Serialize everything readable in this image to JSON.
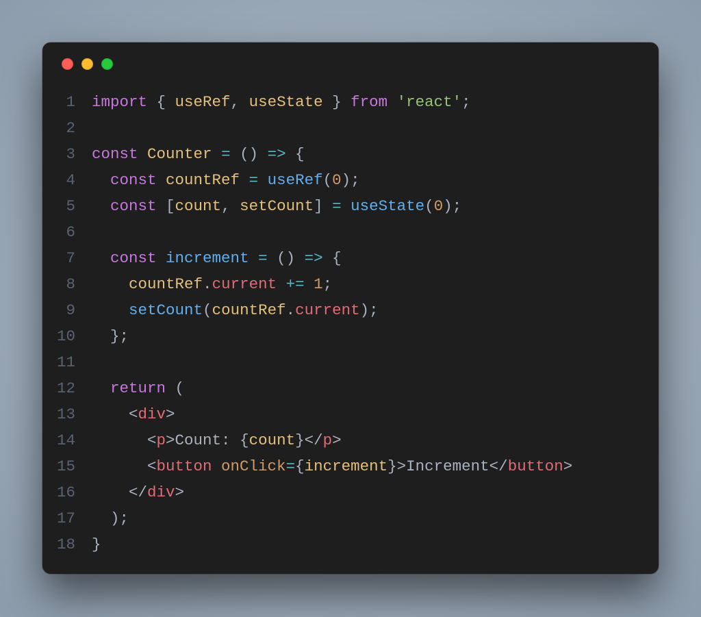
{
  "window": {
    "controls": [
      "close",
      "minimize",
      "zoom"
    ]
  },
  "editor": {
    "line_numbers": [
      "1",
      "2",
      "3",
      "4",
      "5",
      "6",
      "7",
      "8",
      "9",
      "10",
      "11",
      "12",
      "13",
      "14",
      "15",
      "16",
      "17",
      "18"
    ],
    "lines": [
      [
        {
          "t": "key",
          "s": "import"
        },
        {
          "t": "def",
          "s": " { "
        },
        {
          "t": "var",
          "s": "useRef"
        },
        {
          "t": "def",
          "s": ", "
        },
        {
          "t": "var",
          "s": "useState"
        },
        {
          "t": "def",
          "s": " } "
        },
        {
          "t": "key",
          "s": "from"
        },
        {
          "t": "def",
          "s": " "
        },
        {
          "t": "str",
          "s": "'react'"
        },
        {
          "t": "def",
          "s": ";"
        }
      ],
      [],
      [
        {
          "t": "key",
          "s": "const"
        },
        {
          "t": "def",
          "s": " "
        },
        {
          "t": "var",
          "s": "Counter"
        },
        {
          "t": "def",
          "s": " "
        },
        {
          "t": "op",
          "s": "="
        },
        {
          "t": "def",
          "s": " () "
        },
        {
          "t": "op",
          "s": "=>"
        },
        {
          "t": "def",
          "s": " {"
        }
      ],
      [
        {
          "t": "def",
          "s": "  "
        },
        {
          "t": "key",
          "s": "const"
        },
        {
          "t": "def",
          "s": " "
        },
        {
          "t": "var",
          "s": "countRef"
        },
        {
          "t": "def",
          "s": " "
        },
        {
          "t": "op",
          "s": "="
        },
        {
          "t": "def",
          "s": " "
        },
        {
          "t": "fn",
          "s": "useRef"
        },
        {
          "t": "def",
          "s": "("
        },
        {
          "t": "num",
          "s": "0"
        },
        {
          "t": "def",
          "s": ");"
        }
      ],
      [
        {
          "t": "def",
          "s": "  "
        },
        {
          "t": "key",
          "s": "const"
        },
        {
          "t": "def",
          "s": " ["
        },
        {
          "t": "var",
          "s": "count"
        },
        {
          "t": "def",
          "s": ", "
        },
        {
          "t": "var",
          "s": "setCount"
        },
        {
          "t": "def",
          "s": "] "
        },
        {
          "t": "op",
          "s": "="
        },
        {
          "t": "def",
          "s": " "
        },
        {
          "t": "fn",
          "s": "useState"
        },
        {
          "t": "def",
          "s": "("
        },
        {
          "t": "num",
          "s": "0"
        },
        {
          "t": "def",
          "s": ");"
        }
      ],
      [],
      [
        {
          "t": "def",
          "s": "  "
        },
        {
          "t": "key",
          "s": "const"
        },
        {
          "t": "def",
          "s": " "
        },
        {
          "t": "fn",
          "s": "increment"
        },
        {
          "t": "def",
          "s": " "
        },
        {
          "t": "op",
          "s": "="
        },
        {
          "t": "def",
          "s": " () "
        },
        {
          "t": "op",
          "s": "=>"
        },
        {
          "t": "def",
          "s": " {"
        }
      ],
      [
        {
          "t": "def",
          "s": "    "
        },
        {
          "t": "var",
          "s": "countRef"
        },
        {
          "t": "def",
          "s": "."
        },
        {
          "t": "prop",
          "s": "current"
        },
        {
          "t": "def",
          "s": " "
        },
        {
          "t": "op",
          "s": "+="
        },
        {
          "t": "def",
          "s": " "
        },
        {
          "t": "num",
          "s": "1"
        },
        {
          "t": "def",
          "s": ";"
        }
      ],
      [
        {
          "t": "def",
          "s": "    "
        },
        {
          "t": "fn",
          "s": "setCount"
        },
        {
          "t": "def",
          "s": "("
        },
        {
          "t": "var",
          "s": "countRef"
        },
        {
          "t": "def",
          "s": "."
        },
        {
          "t": "prop",
          "s": "current"
        },
        {
          "t": "def",
          "s": ");"
        }
      ],
      [
        {
          "t": "def",
          "s": "  };"
        }
      ],
      [],
      [
        {
          "t": "def",
          "s": "  "
        },
        {
          "t": "key",
          "s": "return"
        },
        {
          "t": "def",
          "s": " ("
        }
      ],
      [
        {
          "t": "def",
          "s": "    <"
        },
        {
          "t": "tag",
          "s": "div"
        },
        {
          "t": "def",
          "s": ">"
        }
      ],
      [
        {
          "t": "def",
          "s": "      <"
        },
        {
          "t": "tag",
          "s": "p"
        },
        {
          "t": "def",
          "s": ">"
        },
        {
          "t": "plain",
          "s": "Count: "
        },
        {
          "t": "def",
          "s": "{"
        },
        {
          "t": "var",
          "s": "count"
        },
        {
          "t": "def",
          "s": "}</"
        },
        {
          "t": "tag",
          "s": "p"
        },
        {
          "t": "def",
          "s": ">"
        }
      ],
      [
        {
          "t": "def",
          "s": "      <"
        },
        {
          "t": "tag",
          "s": "button"
        },
        {
          "t": "def",
          "s": " "
        },
        {
          "t": "attr",
          "s": "onClick"
        },
        {
          "t": "op",
          "s": "="
        },
        {
          "t": "def",
          "s": "{"
        },
        {
          "t": "var",
          "s": "increment"
        },
        {
          "t": "def",
          "s": "}>"
        },
        {
          "t": "plain",
          "s": "Increment"
        },
        {
          "t": "def",
          "s": "</"
        },
        {
          "t": "tag",
          "s": "button"
        },
        {
          "t": "def",
          "s": ">"
        }
      ],
      [
        {
          "t": "def",
          "s": "    </"
        },
        {
          "t": "tag",
          "s": "div"
        },
        {
          "t": "def",
          "s": ">"
        }
      ],
      [
        {
          "t": "def",
          "s": "  );"
        }
      ],
      [
        {
          "t": "def",
          "s": "}"
        }
      ]
    ]
  }
}
